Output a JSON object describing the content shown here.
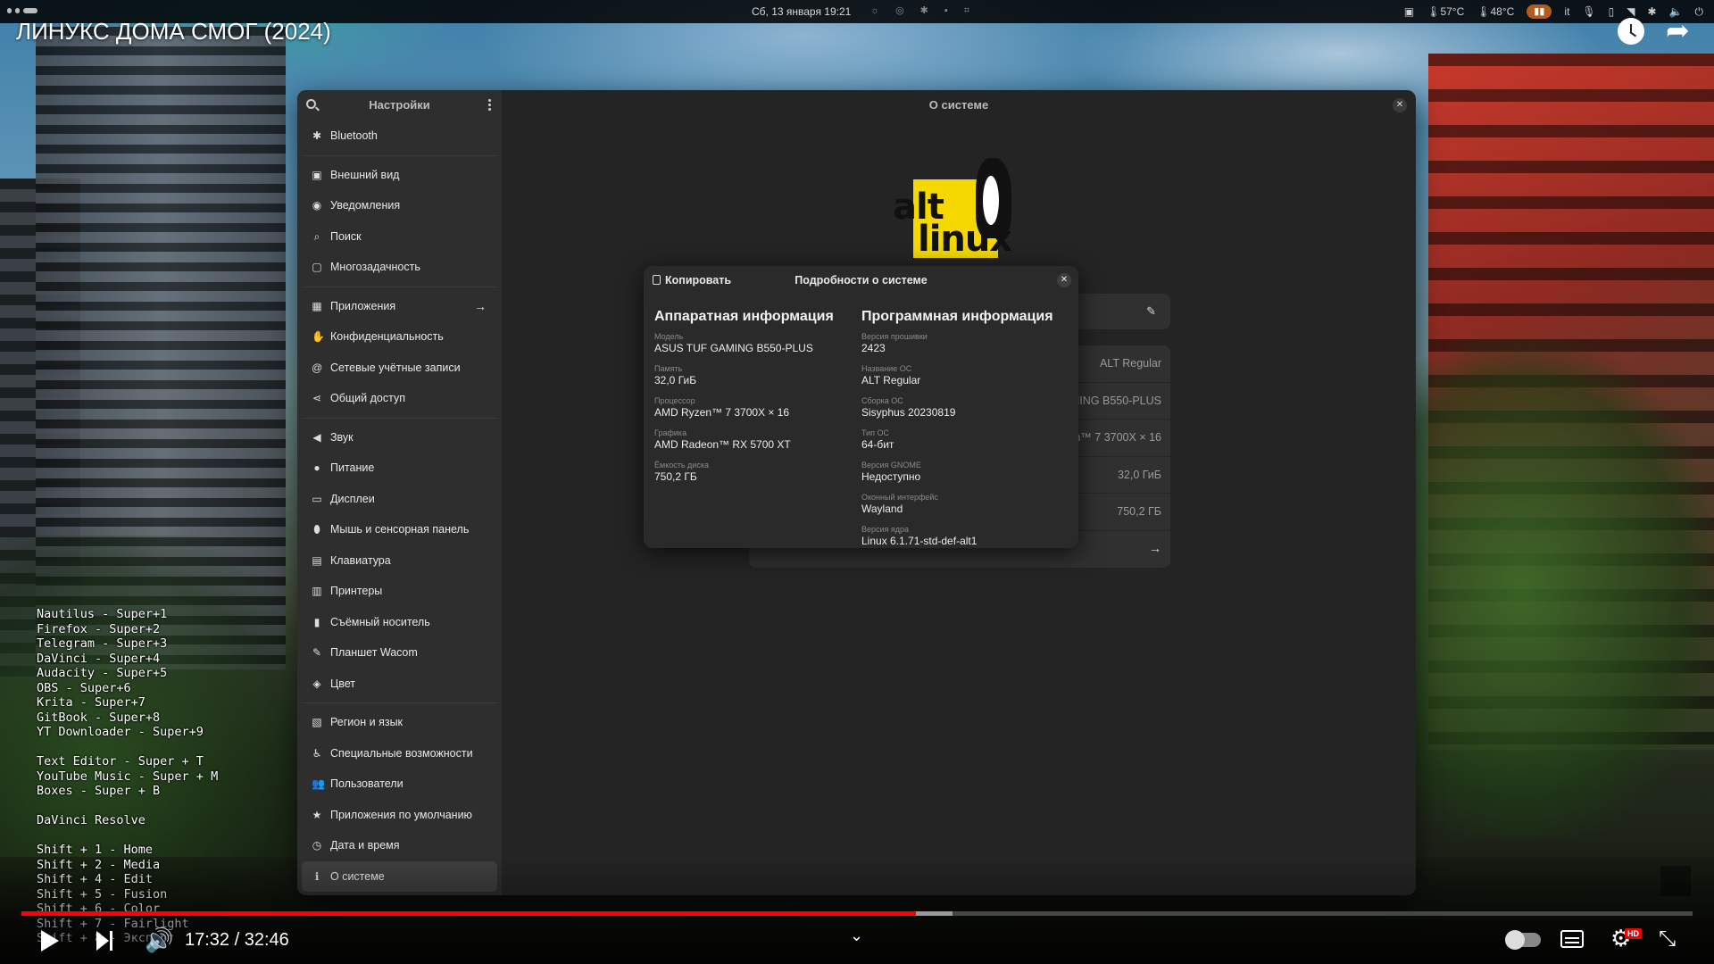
{
  "topbar": {
    "clock": "Сб, 13 января  19:21",
    "cpu_temp": "57°C",
    "gpu_temp": "48°C",
    "keyboard_layout": "it"
  },
  "video": {
    "title": "ЛИНУКС ДОМА СМОГ (2024)",
    "current_time": "17:32",
    "duration": "32:46",
    "time_display": "17:32 / 32:46",
    "played_fraction": 0.535,
    "buffered_fraction": 0.557,
    "quality_badge": "HD"
  },
  "settings": {
    "sidebar_title": "Настройки",
    "window_title": "О системе",
    "sidebar": [
      {
        "label": "Bluetooth",
        "icon": "bluetooth-icon"
      },
      {
        "sep": true
      },
      {
        "label": "Внешний вид",
        "icon": "appearance-icon"
      },
      {
        "label": "Уведомления",
        "icon": "notifications-icon"
      },
      {
        "label": "Поиск",
        "icon": "search-icon"
      },
      {
        "label": "Многозадачность",
        "icon": "multitasking-icon"
      },
      {
        "sep": true
      },
      {
        "label": "Приложения",
        "icon": "apps-icon",
        "arrow": true
      },
      {
        "label": "Конфиденциальность",
        "icon": "privacy-icon"
      },
      {
        "label": "Сетевые учётные записи",
        "icon": "online-accounts-icon"
      },
      {
        "label": "Общий доступ",
        "icon": "sharing-icon"
      },
      {
        "sep": true
      },
      {
        "label": "Звук",
        "icon": "sound-icon"
      },
      {
        "label": "Питание",
        "icon": "power-icon"
      },
      {
        "label": "Дисплеи",
        "icon": "display-icon"
      },
      {
        "label": "Мышь и сенсорная панель",
        "icon": "mouse-icon"
      },
      {
        "label": "Клавиатура",
        "icon": "keyboard-icon"
      },
      {
        "label": "Принтеры",
        "icon": "printer-icon"
      },
      {
        "label": "Съёмный носитель",
        "icon": "removable-media-icon"
      },
      {
        "label": "Планшет Wacom",
        "icon": "wacom-icon"
      },
      {
        "label": "Цвет",
        "icon": "color-icon"
      },
      {
        "sep": true
      },
      {
        "label": "Регион и язык",
        "icon": "region-icon"
      },
      {
        "label": "Специальные возможности",
        "icon": "accessibility-icon"
      },
      {
        "label": "Пользователи",
        "icon": "users-icon"
      },
      {
        "label": "Приложения по умолчанию",
        "icon": "default-apps-icon"
      },
      {
        "label": "Дата и время",
        "icon": "clock-icon"
      },
      {
        "label": "О системе",
        "icon": "about-icon",
        "active": true
      }
    ],
    "about_rows": [
      "ALT Regular",
      "ASUS TUF GAMING B550-PLUS",
      "AMD Ryzen™ 7 3700X × 16",
      "32,0 ГиБ",
      "750,2 ГБ"
    ]
  },
  "dialog": {
    "copy_label": "Копировать",
    "title": "Подробности о системе",
    "hardware": {
      "heading": "Аппаратная информация",
      "fields": [
        {
          "label": "Модель",
          "value": "ASUS TUF GAMING B550-PLUS"
        },
        {
          "label": "Память",
          "value": "32,0 ГиБ"
        },
        {
          "label": "Процессор",
          "value": "AMD Ryzen™ 7 3700X × 16"
        },
        {
          "label": "Графика",
          "value": "AMD Radeon™ RX 5700 XT"
        },
        {
          "label": "Ёмкость диска",
          "value": "750,2 ГБ"
        }
      ]
    },
    "software": {
      "heading": "Программная информация",
      "fields": [
        {
          "label": "Версия прошивки",
          "value": "2423"
        },
        {
          "label": "Название ОС",
          "value": "ALT Regular"
        },
        {
          "label": "Сборка ОС",
          "value": "Sisyphus 20230819"
        },
        {
          "label": "Тип ОС",
          "value": "64-бит"
        },
        {
          "label": "Версия GNOME",
          "value": "Недоступно"
        },
        {
          "label": "Оконный интерфейс",
          "value": "Wayland"
        },
        {
          "label": "Версия ядра",
          "value": "Linux 6.1.71-std-def-alt1"
        }
      ]
    }
  },
  "shortcuts": [
    "Nautilus - Super+1",
    "Firefox - Super+2",
    "Telegram - Super+3",
    "DaVinci - Super+4",
    "Audacity - Super+5",
    "OBS - Super+6",
    "Krita - Super+7",
    "GitBook - Super+8",
    "YT Downloader - Super+9",
    "",
    "Text Editor - Super + T",
    "YouTube Music - Super + M",
    "Boxes - Super + B",
    "",
    "DaVinci Resolve",
    "",
    "Shift + 1 - Home",
    "Shift + 2 - Media",
    "Shift + 4 - Edit",
    "Shift + 5 - Fusion",
    "Shift + 6 - Color",
    "Shift + 7 - Fairlight",
    "Shift + 8 - Экспорт"
  ]
}
